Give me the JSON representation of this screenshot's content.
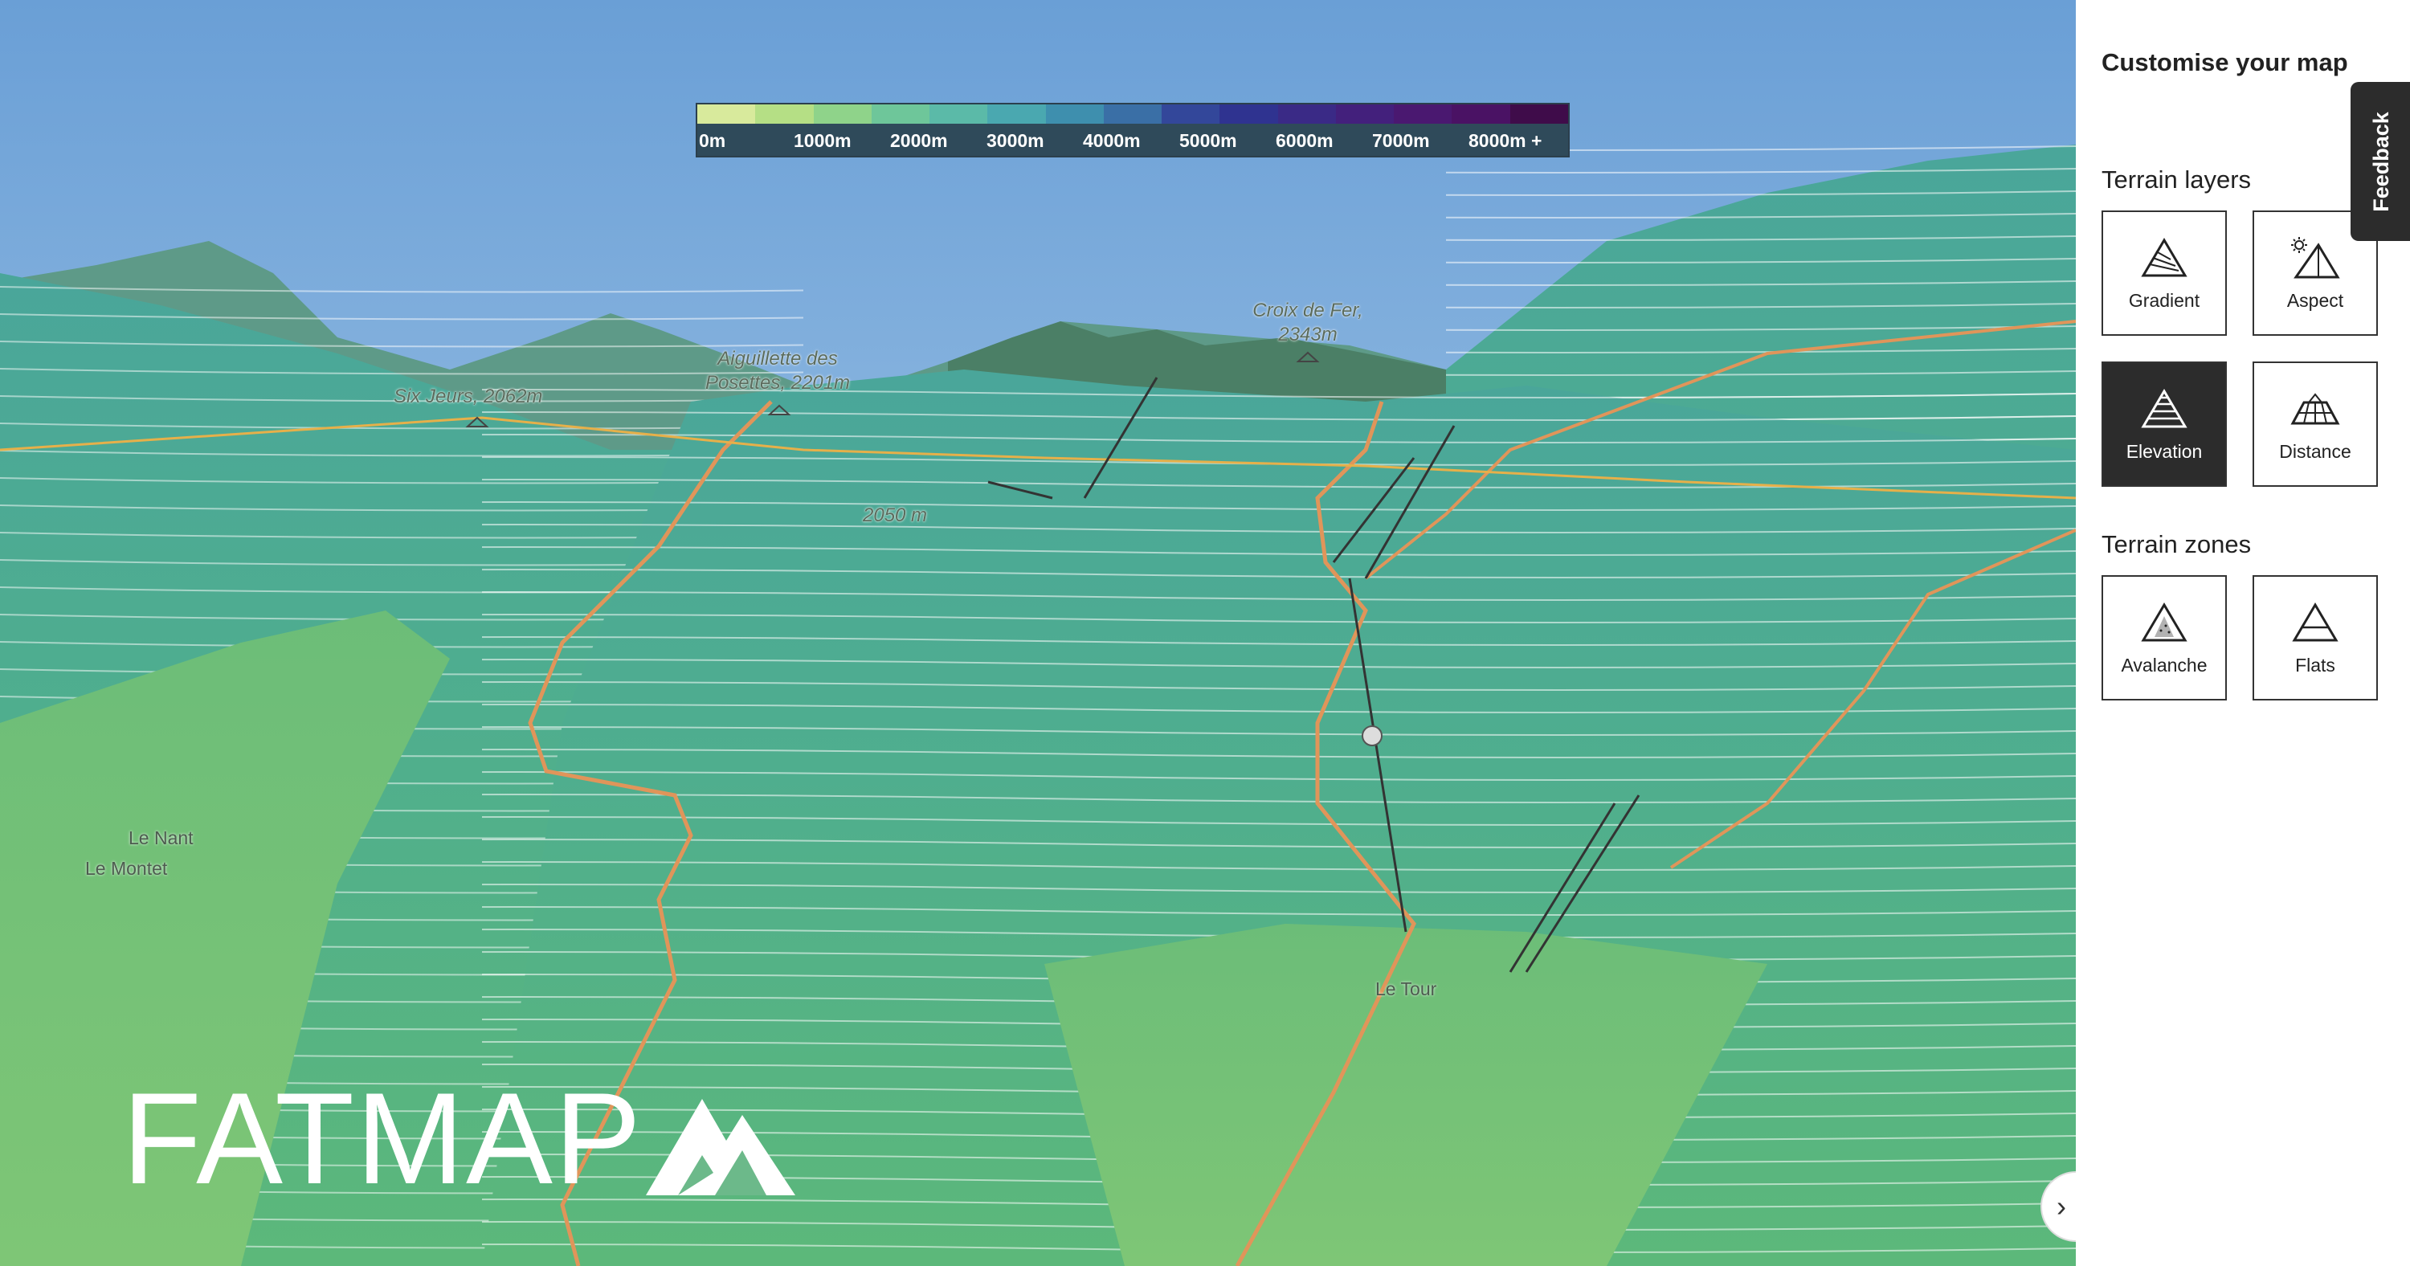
{
  "legend": {
    "colors": [
      "#d8ea9c",
      "#b5df85",
      "#8fd38a",
      "#6ec69a",
      "#5bbaa8",
      "#4aa8b0",
      "#3e8fae",
      "#3a6fa6",
      "#33479a",
      "#2f3390",
      "#3a2a86",
      "#43207c",
      "#4a1870",
      "#4a1264",
      "#3f0c4a"
    ],
    "labels": [
      "0m",
      "1000m",
      "2000m",
      "3000m",
      "4000m",
      "5000m",
      "6000m",
      "7000m",
      "8000m +"
    ]
  },
  "map": {
    "peaks": [
      {
        "name": "Six Jeurs, 2062m"
      },
      {
        "name": "Aiguillette des Posettes, 2201m"
      },
      {
        "name": "Croix de Fer, 2343m"
      }
    ],
    "contour_label": "2050 m",
    "places": [
      "Le Nant",
      "Le Montet",
      "Le Tour"
    ],
    "logo_text": "FATMAP",
    "expand_icon": "chevron-right-icon"
  },
  "panel": {
    "title": "Customise your map",
    "terrain_layers_title": "Terrain layers",
    "terrain_layers": [
      {
        "label": "Gradient",
        "icon": "gradient-icon",
        "active": false
      },
      {
        "label": "Aspect",
        "icon": "aspect-icon",
        "active": false
      },
      {
        "label": "Elevation",
        "icon": "elevation-icon",
        "active": true
      },
      {
        "label": "Distance",
        "icon": "distance-icon",
        "active": false
      }
    ],
    "terrain_zones_title": "Terrain zones",
    "terrain_zones": [
      {
        "label": "Avalanche",
        "icon": "avalanche-icon",
        "active": false
      },
      {
        "label": "Flats",
        "icon": "flats-icon",
        "active": false
      }
    ],
    "feedback_label": "Feedback"
  },
  "colors": {
    "sky_top": "#6fa3d8",
    "terrain_teal": "#4fae97",
    "terrain_green": "#6dbf7a",
    "route_orange": "#e0955a",
    "active_tile": "#2c2c2c"
  }
}
